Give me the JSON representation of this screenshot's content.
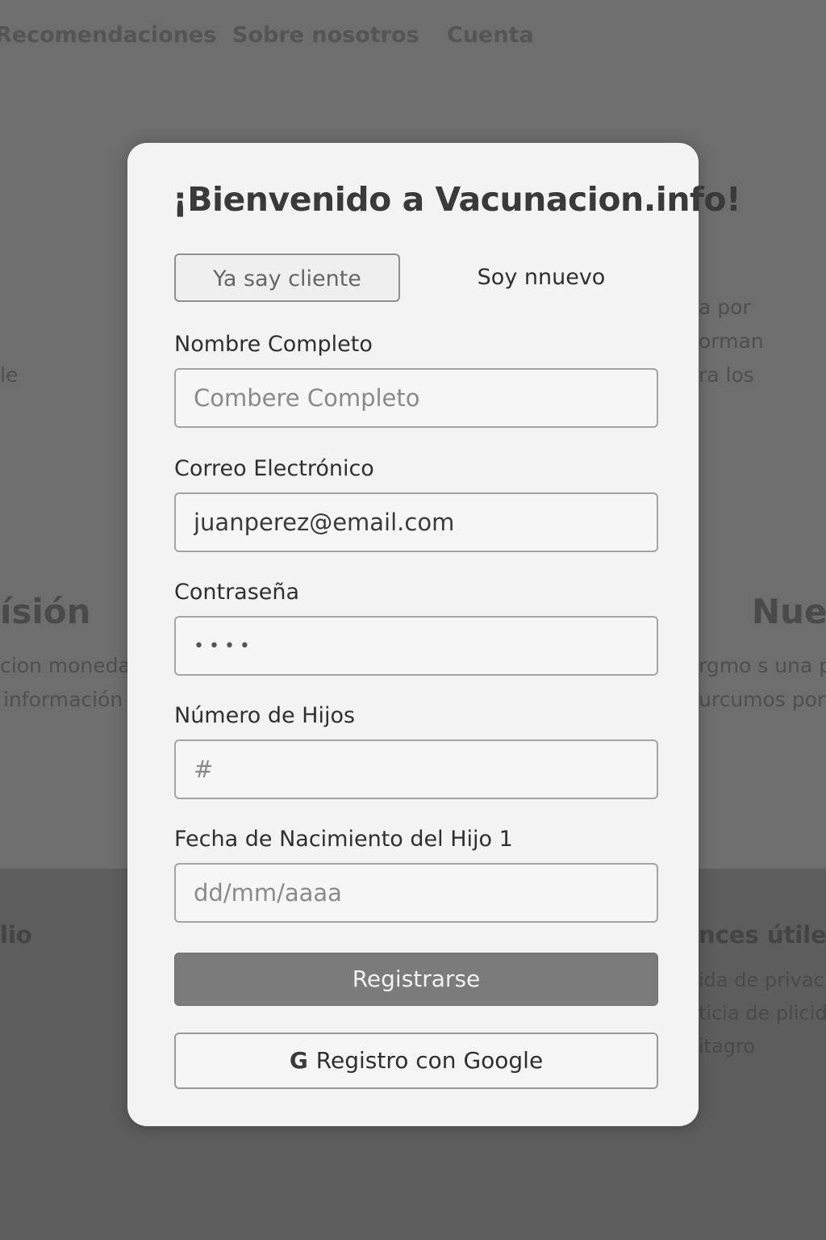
{
  "nav": {
    "items": [
      "Recomendaciones",
      "Sobre nosotros",
      "Cuenta"
    ]
  },
  "background": {
    "right_text": [
      "a por",
      "orman",
      "ra los"
    ],
    "left_fragment": "le",
    "section_left_title": "ísión",
    "section_left_lines": [
      "cion moneda",
      "información"
    ],
    "section_right_title": "Nues",
    "section_right_lines": [
      "rgmo s una p",
      "urcumos por"
    ],
    "footer_left_title": "lio",
    "footer_right_title": "nces útiles",
    "footer_right_links": [
      "ida de privacio",
      "ticia de plicida",
      "itagro"
    ]
  },
  "modal": {
    "title": "¡Bienvenido a Vacunacion.info!",
    "tabs": {
      "existing_client": "Ya say cliente",
      "new_user": "Soy nnuevo"
    },
    "fields": {
      "full_name": {
        "label": "Nombre Completo",
        "placeholder": "Combere Completo",
        "value": ""
      },
      "email": {
        "label": "Correo Electrónico",
        "value": "juanperez@email.com"
      },
      "password": {
        "label": "Contraseña",
        "value": "••••"
      },
      "children_count": {
        "label": "Número de Hijos",
        "placeholder": "#"
      },
      "child_birthdate": {
        "label": "Fecha de Nacimiento del Hijo 1",
        "placeholder": "dd/mm/aaaa"
      }
    },
    "register_button": "Registrarse",
    "google_button": "Registro con Google",
    "google_icon": "G"
  }
}
